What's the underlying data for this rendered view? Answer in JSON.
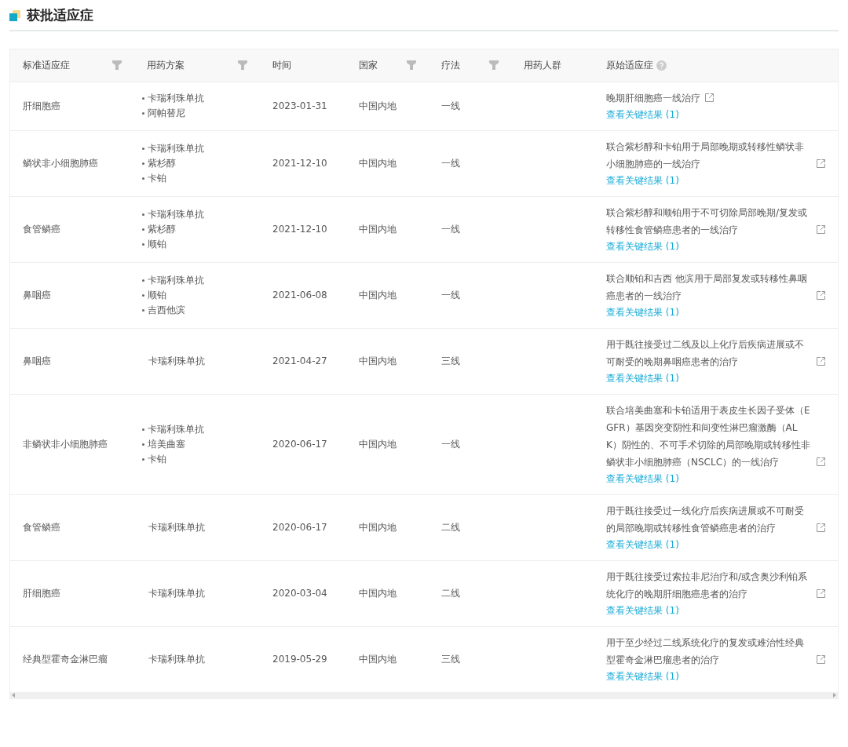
{
  "section": {
    "title": "获批适应症"
  },
  "table": {
    "columns": [
      {
        "label": "标准适应症",
        "filter": true,
        "help": false
      },
      {
        "label": "用药方案",
        "filter": true,
        "help": false
      },
      {
        "label": "时间",
        "filter": false,
        "help": false
      },
      {
        "label": "国家",
        "filter": true,
        "help": false
      },
      {
        "label": "疗法",
        "filter": true,
        "help": false
      },
      {
        "label": "用药人群",
        "filter": false,
        "help": false
      },
      {
        "label": "原始适应症",
        "filter": false,
        "help": true
      }
    ],
    "rows": [
      {
        "indication": "肝细胞癌",
        "regimen": [
          "卡瑞利珠单抗",
          "阿帕替尼"
        ],
        "date": "2023-01-31",
        "country": "中国内地",
        "line": "一线",
        "original": "晚期肝细胞癌一线治疗",
        "link": "查看关键结果 (1)"
      },
      {
        "indication": "鳞状非小细胞肺癌",
        "regimen": [
          "卡瑞利珠单抗",
          "紫杉醇",
          "卡铂"
        ],
        "date": "2021-12-10",
        "country": "中国内地",
        "line": "一线",
        "original": "联合紫杉醇和卡铂用于局部晚期或转移性鳞状非小细胞肺癌的一线治疗",
        "link": "查看关键结果 (1)"
      },
      {
        "indication": "食管鳞癌",
        "regimen": [
          "卡瑞利珠单抗",
          "紫杉醇",
          "顺铂"
        ],
        "date": "2021-12-10",
        "country": "中国内地",
        "line": "一线",
        "original": "联合紫杉醇和顺铂用于不可切除局部晚期/复发或转移性食管鳞癌患者的一线治疗",
        "link": "查看关键结果 (1)"
      },
      {
        "indication": "鼻咽癌",
        "regimen": [
          "卡瑞利珠单抗",
          "顺铂",
          "吉西他滨"
        ],
        "date": "2021-06-08",
        "country": "中国内地",
        "line": "一线",
        "original": "联合顺铂和吉西 他滨用于局部复发或转移性鼻咽癌患者的一线治疗",
        "link": "查看关键结果 (1)"
      },
      {
        "indication": "鼻咽癌",
        "regimen": [
          "卡瑞利珠单抗"
        ],
        "date": "2021-04-27",
        "country": "中国内地",
        "line": "三线",
        "original": "用于既往接受过二线及以上化疗后疾病进展或不可耐受的晚期鼻咽癌患者的治疗",
        "link": "查看关键结果 (1)"
      },
      {
        "indication": "非鳞状非小细胞肺癌",
        "regimen": [
          "卡瑞利珠单抗",
          "培美曲塞",
          "卡铂"
        ],
        "date": "2020-06-17",
        "country": "中国内地",
        "line": "一线",
        "original": "联合培美曲塞和卡铂适用于表皮生长因子受体（EGFR）基因突变阴性和间变性淋巴瘤激酶（ALK）阴性的、不可手术切除的局部晚期或转移性非鳞状非小细胞肺癌（NSCLC）的一线治疗",
        "link": "查看关键结果 (1)"
      },
      {
        "indication": "食管鳞癌",
        "regimen": [
          "卡瑞利珠单抗"
        ],
        "date": "2020-06-17",
        "country": "中国内地",
        "line": "二线",
        "original": "用于既往接受过一线化疗后疾病进展或不可耐受的局部晚期或转移性食管鳞癌患者的治疗",
        "link": "查看关键结果 (1)"
      },
      {
        "indication": "肝细胞癌",
        "regimen": [
          "卡瑞利珠单抗"
        ],
        "date": "2020-03-04",
        "country": "中国内地",
        "line": "二线",
        "original": "用于既往接受过索拉非尼治疗和/或含奥沙利铂系统化疗的晚期肝细胞癌患者的治疗",
        "link": "查看关键结果 (1)"
      },
      {
        "indication": "经典型霍奇金淋巴瘤",
        "regimen": [
          "卡瑞利珠单抗"
        ],
        "date": "2019-05-29",
        "country": "中国内地",
        "line": "三线",
        "original": "用于至少经过二线系统化疗的复发或难治性经典型霍奇金淋巴瘤患者的治疗",
        "link": "查看关键结果 (1)"
      }
    ]
  }
}
